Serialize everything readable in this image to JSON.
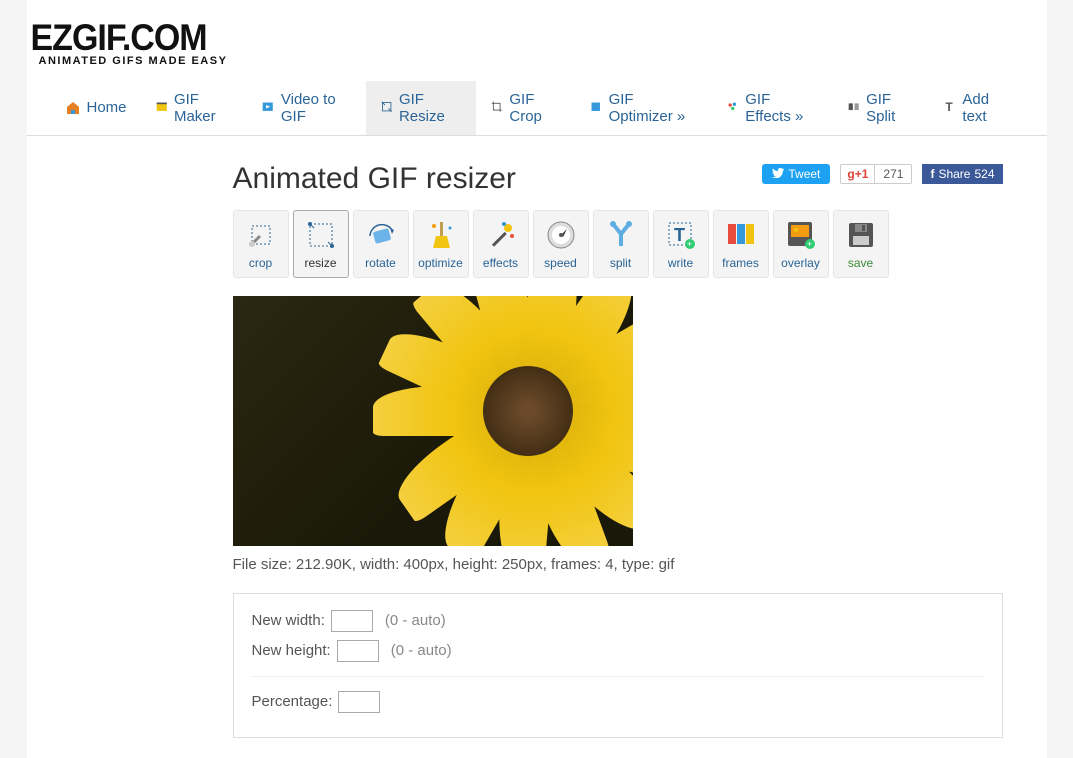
{
  "brand": {
    "name": "EZGIF.COM",
    "tagline": "ANIMATED GIFS MADE EASY"
  },
  "nav": {
    "home": "Home",
    "maker": "GIF Maker",
    "video": "Video to GIF",
    "resize": "GIF Resize",
    "crop": "GIF Crop",
    "optimizer": "GIF Optimizer »",
    "effects": "GIF Effects »",
    "split": "GIF Split",
    "addtext": "Add text"
  },
  "page_title": "Animated GIF resizer",
  "share": {
    "tweet": "Tweet",
    "gplus_label": "+1",
    "gplus_count": "271",
    "fb_label": "Share",
    "fb_count": "524"
  },
  "tools": {
    "crop": "crop",
    "resize": "resize",
    "rotate": "rotate",
    "optimize": "optimize",
    "effects": "effects",
    "speed": "speed",
    "split": "split",
    "write": "write",
    "frames": "frames",
    "overlay": "overlay",
    "save": "save"
  },
  "fileinfo": "File size: 212.90K, width: 400px, height: 250px, frames: 4, type: gif",
  "form": {
    "width_label": "New width:",
    "width_value": "",
    "height_label": "New height:",
    "height_value": "",
    "auto_hint": "(0 - auto)",
    "percentage_label": "Percentage:",
    "percentage_value": ""
  }
}
